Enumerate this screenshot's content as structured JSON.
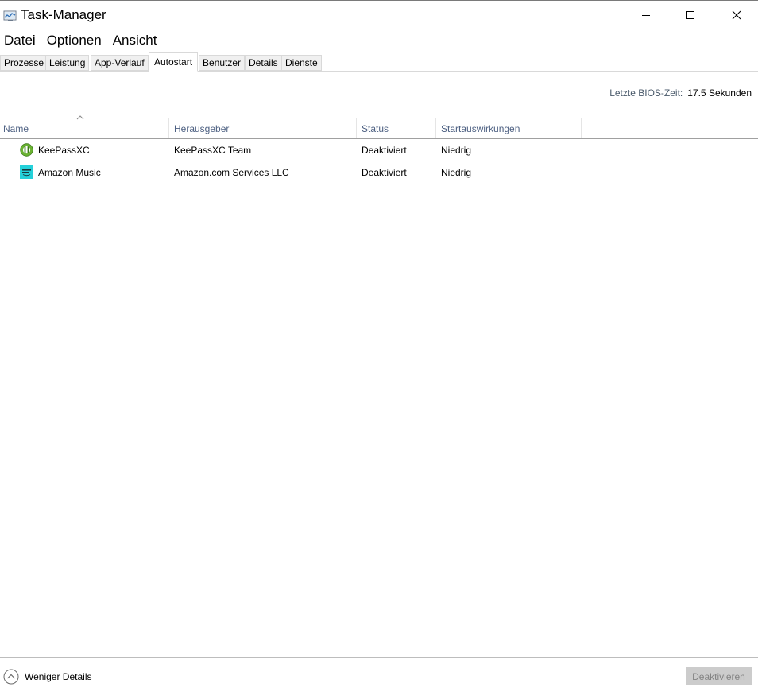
{
  "window": {
    "title": "Task-Manager",
    "icon": "task-manager-icon",
    "controls": [
      "minimize-icon",
      "maximize-icon",
      "close-icon"
    ]
  },
  "menu": [
    "Datei",
    "Optionen",
    "Ansicht"
  ],
  "tabs": [
    "Prozesse",
    "Leistung",
    "App-Verlauf",
    "Autostart",
    "Benutzer",
    "Details",
    "Dienste"
  ],
  "active_tab": "Autostart",
  "bios": {
    "label": "Letzte BIOS-Zeit:",
    "value": "17.5 Sekunden"
  },
  "table": {
    "columns": [
      "Name",
      "Herausgeber",
      "Status",
      "Startauswirkungen"
    ],
    "sorted_column": "Name",
    "rows": [
      {
        "icon": "keepassxc-icon",
        "name": "KeePassXC",
        "publisher": "KeePassXC Team",
        "status": "Deaktiviert",
        "impact": "Niedrig"
      },
      {
        "icon": "amazon-music-icon",
        "name": "Amazon Music",
        "publisher": "Amazon.com Services LLC",
        "status": "Deaktiviert",
        "impact": "Niedrig"
      }
    ]
  },
  "footer": {
    "fewer_details": "Weniger Details",
    "disable_button": "Deaktivieren"
  },
  "colors": {
    "column_header_text": "#4d6082",
    "disabled_button_bg": "#cccccc",
    "tab_bg": "#f0f0f0"
  }
}
